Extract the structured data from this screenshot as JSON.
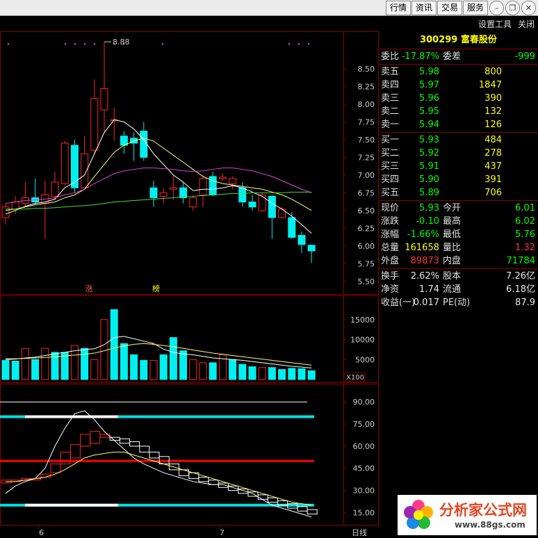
{
  "toolbar": {
    "buttons": [
      "行情",
      "资讯",
      "交易",
      "服务"
    ],
    "window_controls": [
      "minimize-icon",
      "restore-icon",
      "close-icon"
    ],
    "links": [
      "设置工具",
      "关闭"
    ]
  },
  "quote": {
    "code": "300299",
    "name": "富春股份",
    "ratio_label": "委比",
    "ratio_value": "-17.87%",
    "diff_label": "委差",
    "diff_value": "-999",
    "asks": [
      {
        "label": "卖五",
        "price": "5.98",
        "vol": "800"
      },
      {
        "label": "卖四",
        "price": "5.97",
        "vol": "1847"
      },
      {
        "label": "卖三",
        "price": "5.96",
        "vol": "390"
      },
      {
        "label": "卖二",
        "price": "5.95",
        "vol": "132"
      },
      {
        "label": "卖一",
        "price": "5.94",
        "vol": "126"
      }
    ],
    "bids": [
      {
        "label": "买一",
        "price": "5.93",
        "vol": "484"
      },
      {
        "label": "买二",
        "price": "5.92",
        "vol": "278"
      },
      {
        "label": "买三",
        "price": "5.91",
        "vol": "437"
      },
      {
        "label": "买四",
        "price": "5.90",
        "vol": "391"
      },
      {
        "label": "买五",
        "price": "5.89",
        "vol": "706"
      }
    ],
    "stats": [
      {
        "l1": "现价",
        "v1": "5.93",
        "c1": "grn",
        "l2": "今开",
        "v2": "6.01",
        "c2": "grn"
      },
      {
        "l1": "涨跌",
        "v1": "-0.10",
        "c1": "grn",
        "l2": "最高",
        "v2": "6.02",
        "c2": "grn"
      },
      {
        "l1": "涨幅",
        "v1": "-1.66%",
        "c1": "grn",
        "l2": "最低",
        "v2": "5.76",
        "c2": "grn"
      },
      {
        "l1": "总量",
        "v1": "161658",
        "c1": "yel",
        "l2": "量比",
        "v2": "1.32",
        "c2": "red"
      },
      {
        "l1": "外盘",
        "v1": "89873",
        "c1": "red",
        "l2": "内盘",
        "v2": "71784",
        "c2": "grn"
      }
    ],
    "stats2": [
      {
        "l1": "换手",
        "v1": "2.62%",
        "l2": "股本",
        "v2": "7.26亿"
      },
      {
        "l1": "净资",
        "v1": "1.74",
        "l2": "流通",
        "v2": "6.18亿"
      },
      {
        "l1": "收益(一)",
        "v1": "0.017",
        "l2": "PE(动)",
        "v2": "87.9"
      }
    ]
  },
  "chart_data": [
    {
      "type": "candlestick",
      "y_ticks": [
        "8.50",
        "8.25",
        "8.00",
        "7.75",
        "7.50",
        "7.25",
        "7.00",
        "6.75",
        "6.50",
        "6.25",
        "6.00",
        "5.75",
        "5.50"
      ],
      "ylim": [
        5.4,
        8.95
      ],
      "peak_label": "8.88",
      "markers": [
        "涨",
        "榜"
      ],
      "candles": [
        {
          "o": 6.4,
          "h": 6.6,
          "l": 6.3,
          "c": 6.55
        },
        {
          "o": 6.52,
          "h": 6.7,
          "l": 6.45,
          "c": 6.62
        },
        {
          "o": 6.6,
          "h": 6.9,
          "l": 6.55,
          "c": 6.68
        },
        {
          "o": 6.68,
          "h": 6.95,
          "l": 6.58,
          "c": 6.62
        },
        {
          "o": 6.6,
          "h": 6.92,
          "l": 6.1,
          "c": 6.72
        },
        {
          "o": 6.7,
          "h": 7.05,
          "l": 6.65,
          "c": 6.9
        },
        {
          "o": 6.88,
          "h": 7.48,
          "l": 6.85,
          "c": 7.45
        },
        {
          "o": 7.42,
          "h": 7.5,
          "l": 6.75,
          "c": 6.82
        },
        {
          "o": 6.82,
          "h": 7.55,
          "l": 6.8,
          "c": 7.3
        },
        {
          "o": 7.35,
          "h": 8.35,
          "l": 7.3,
          "c": 8.08
        },
        {
          "o": 7.92,
          "h": 8.88,
          "l": 7.6,
          "c": 8.22
        },
        {
          "o": 7.78,
          "h": 7.95,
          "l": 7.48,
          "c": 7.78
        },
        {
          "o": 7.55,
          "h": 7.62,
          "l": 7.3,
          "c": 7.42
        },
        {
          "o": 7.52,
          "h": 7.6,
          "l": 7.2,
          "c": 7.45
        },
        {
          "o": 7.62,
          "h": 7.75,
          "l": 7.2,
          "c": 7.25
        },
        {
          "o": 6.82,
          "h": 6.92,
          "l": 6.55,
          "c": 6.68
        },
        {
          "o": 6.7,
          "h": 6.82,
          "l": 6.6,
          "c": 6.75
        },
        {
          "o": 6.8,
          "h": 7.0,
          "l": 6.65,
          "c": 6.82
        },
        {
          "o": 6.82,
          "h": 6.9,
          "l": 6.6,
          "c": 6.68
        },
        {
          "o": 6.55,
          "h": 6.72,
          "l": 6.5,
          "c": 6.68
        },
        {
          "o": 6.72,
          "h": 7.0,
          "l": 6.55,
          "c": 6.95
        },
        {
          "o": 6.98,
          "h": 7.05,
          "l": 6.7,
          "c": 6.72
        },
        {
          "o": 6.95,
          "h": 7.02,
          "l": 6.92,
          "c": 6.97
        },
        {
          "o": 6.88,
          "h": 6.98,
          "l": 6.8,
          "c": 6.95
        },
        {
          "o": 6.82,
          "h": 6.9,
          "l": 6.55,
          "c": 6.62
        },
        {
          "o": 6.62,
          "h": 6.72,
          "l": 6.5,
          "c": 6.55
        },
        {
          "o": 6.5,
          "h": 6.75,
          "l": 6.48,
          "c": 6.72
        },
        {
          "o": 6.7,
          "h": 6.72,
          "l": 6.1,
          "c": 6.4
        },
        {
          "o": 6.4,
          "h": 6.55,
          "l": 6.38,
          "c": 6.52
        },
        {
          "o": 6.4,
          "h": 6.48,
          "l": 6.1,
          "c": 6.12
        },
        {
          "o": 6.15,
          "h": 6.2,
          "l": 5.9,
          "c": 6.02
        },
        {
          "o": 6.01,
          "h": 6.02,
          "l": 5.76,
          "c": 5.93
        }
      ],
      "ma_series": [
        {
          "color": "#ffffff",
          "values": [
            6.45,
            6.5,
            6.56,
            6.6,
            6.62,
            6.66,
            6.82,
            6.9,
            7.0,
            7.3,
            7.6,
            7.78,
            7.75,
            7.65,
            7.5,
            7.3,
            7.15,
            7.0,
            6.9,
            6.78,
            6.8,
            6.8,
            6.82,
            6.85,
            6.82,
            6.76,
            6.7,
            6.6,
            6.52,
            6.42,
            6.3,
            6.18
          ]
        },
        {
          "color": "#ffff66",
          "values": [
            6.5,
            6.52,
            6.55,
            6.58,
            6.6,
            6.62,
            6.68,
            6.72,
            6.8,
            6.98,
            7.15,
            7.32,
            7.42,
            7.48,
            7.52,
            7.48,
            7.38,
            7.28,
            7.18,
            7.08,
            6.98,
            6.92,
            6.88,
            6.86,
            6.84,
            6.82,
            6.8,
            6.76,
            6.72,
            6.66,
            6.58,
            6.5
          ]
        },
        {
          "color": "#dd44dd",
          "values": [
            6.6,
            6.62,
            6.64,
            6.65,
            6.66,
            6.68,
            6.72,
            6.75,
            6.8,
            6.88,
            6.95,
            7.02,
            7.06,
            7.08,
            7.1,
            7.1,
            7.09,
            7.08,
            7.06,
            7.05,
            7.06,
            7.08,
            7.1,
            7.1,
            7.08,
            7.06,
            7.02,
            6.98,
            6.92,
            6.86,
            6.8,
            6.75
          ]
        },
        {
          "color": "#44dd44",
          "values": [
            6.52,
            6.52,
            6.52,
            6.53,
            6.53,
            6.54,
            6.55,
            6.56,
            6.57,
            6.58,
            6.6,
            6.62,
            6.63,
            6.64,
            6.65,
            6.66,
            6.67,
            6.68,
            6.69,
            6.7,
            6.71,
            6.72,
            6.73,
            6.74,
            6.74,
            6.75,
            6.75,
            6.75,
            6.75,
            6.76,
            6.76,
            6.76
          ]
        }
      ],
      "x_labels": [
        "6",
        "7"
      ]
    },
    {
      "type": "bar",
      "y_ticks": [
        "15000",
        "10000",
        "5000"
      ],
      "ylim": [
        0,
        20000
      ],
      "unit_label": "X100",
      "values": [
        4800,
        4600,
        7800,
        5000,
        7800,
        6800,
        6800,
        8500,
        7800,
        5000,
        15000,
        17500,
        9000,
        6200,
        4800,
        4800,
        6200,
        10500,
        7200,
        5000,
        4200,
        4200,
        6200,
        5000,
        3800,
        3200,
        3000,
        3000,
        2500,
        2800,
        2700,
        2200
      ],
      "up": [
        false,
        false,
        true,
        false,
        true,
        false,
        false,
        true,
        false,
        true,
        true,
        false,
        false,
        false,
        false,
        true,
        false,
        false,
        false,
        true,
        true,
        false,
        true,
        false,
        false,
        false,
        true,
        false,
        false,
        false,
        false,
        false
      ],
      "ma_series": [
        {
          "color": "#ffffff",
          "values": [
            5000,
            5100,
            5400,
            5600,
            6000,
            6400,
            6800,
            7200,
            7500,
            7700,
            8700,
            10500,
            10800,
            10200,
            9600,
            9000,
            7600,
            6800,
            6400,
            6200,
            5800,
            5400,
            5200,
            5000,
            4800,
            4500,
            4200,
            3900,
            3600,
            3300,
            3100,
            2900
          ]
        },
        {
          "color": "#ffff66",
          "values": [
            5200,
            5200,
            5300,
            5400,
            5500,
            5700,
            5900,
            6100,
            6300,
            6600,
            7200,
            7900,
            8400,
            8800,
            9000,
            8800,
            8500,
            8200,
            7800,
            7400,
            7000,
            6600,
            6300,
            6000,
            5700,
            5400,
            5100,
            4800,
            4500,
            4200,
            3900,
            3600
          ]
        }
      ]
    },
    {
      "type": "indicator",
      "y_ticks": [
        "90.00",
        "75.00",
        "60.00",
        "45.00",
        "30.00",
        "15.00"
      ],
      "ylim": [
        10,
        100
      ],
      "levels": [
        {
          "value": 90,
          "color": "#ffffff"
        },
        {
          "value": 80,
          "color": "#00e0e0"
        },
        {
          "value": 50,
          "color": "#ff0000"
        },
        {
          "value": 20,
          "color": "#00e0e0"
        }
      ],
      "boxes": [
        {
          "o": 35,
          "c": 37
        },
        {
          "o": 36,
          "c": 37
        },
        {
          "o": 37,
          "c": 38
        },
        {
          "o": 38,
          "c": 38
        },
        {
          "o": 39,
          "c": 41
        },
        {
          "o": 42,
          "c": 48
        },
        {
          "o": 48,
          "c": 56
        },
        {
          "o": 52,
          "c": 61
        },
        {
          "o": 60,
          "c": 68
        },
        {
          "o": 62,
          "c": 70
        },
        {
          "o": 66,
          "c": 68
        },
        {
          "o": 64,
          "c": 66
        },
        {
          "o": 62,
          "c": 65
        },
        {
          "o": 60,
          "c": 63
        },
        {
          "o": 56,
          "c": 60
        },
        {
          "o": 52,
          "c": 56
        },
        {
          "o": 48,
          "c": 53
        },
        {
          "o": 44,
          "c": 48
        },
        {
          "o": 40,
          "c": 44
        },
        {
          "o": 38,
          "c": 42
        },
        {
          "o": 36,
          "c": 39
        },
        {
          "o": 34,
          "c": 37
        },
        {
          "o": 32,
          "c": 35
        },
        {
          "o": 30,
          "c": 33
        },
        {
          "o": 28,
          "c": 31
        },
        {
          "o": 26,
          "c": 29
        },
        {
          "o": 24,
          "c": 27
        },
        {
          "o": 22,
          "c": 25
        },
        {
          "o": 20,
          "c": 23
        },
        {
          "o": 18,
          "c": 21
        },
        {
          "o": 16,
          "c": 19
        },
        {
          "o": 14,
          "c": 17
        }
      ],
      "box_up": [
        true,
        true,
        true,
        true,
        true,
        true,
        true,
        true,
        true,
        true,
        true,
        false,
        false,
        false,
        false,
        false,
        false,
        false,
        false,
        false,
        false,
        false,
        false,
        false,
        false,
        false,
        false,
        false,
        false,
        false,
        false,
        false
      ],
      "line_white": [
        28,
        33,
        36,
        38,
        45,
        60,
        72,
        82,
        84,
        78,
        70,
        64,
        58,
        52,
        48,
        45,
        42,
        40,
        38,
        36,
        35,
        34,
        34,
        32,
        30,
        28,
        24,
        20,
        18,
        16,
        14,
        12
      ],
      "line_yellow": [
        36,
        36,
        37,
        38,
        39,
        41,
        44,
        48,
        52,
        54,
        55,
        56,
        56,
        54,
        52,
        50,
        48,
        46,
        44,
        42,
        40,
        38,
        36,
        34,
        32,
        30,
        28,
        26,
        24,
        22,
        21,
        20
      ],
      "x_footer": "日线"
    }
  ],
  "logo": {
    "text": "分析家公式网",
    "url": "www.88gs.com"
  },
  "colors": {
    "up": "#ff2222",
    "down": "#00f0f0",
    "grid": "#8b0000",
    "axis_text": "#cccccc"
  }
}
